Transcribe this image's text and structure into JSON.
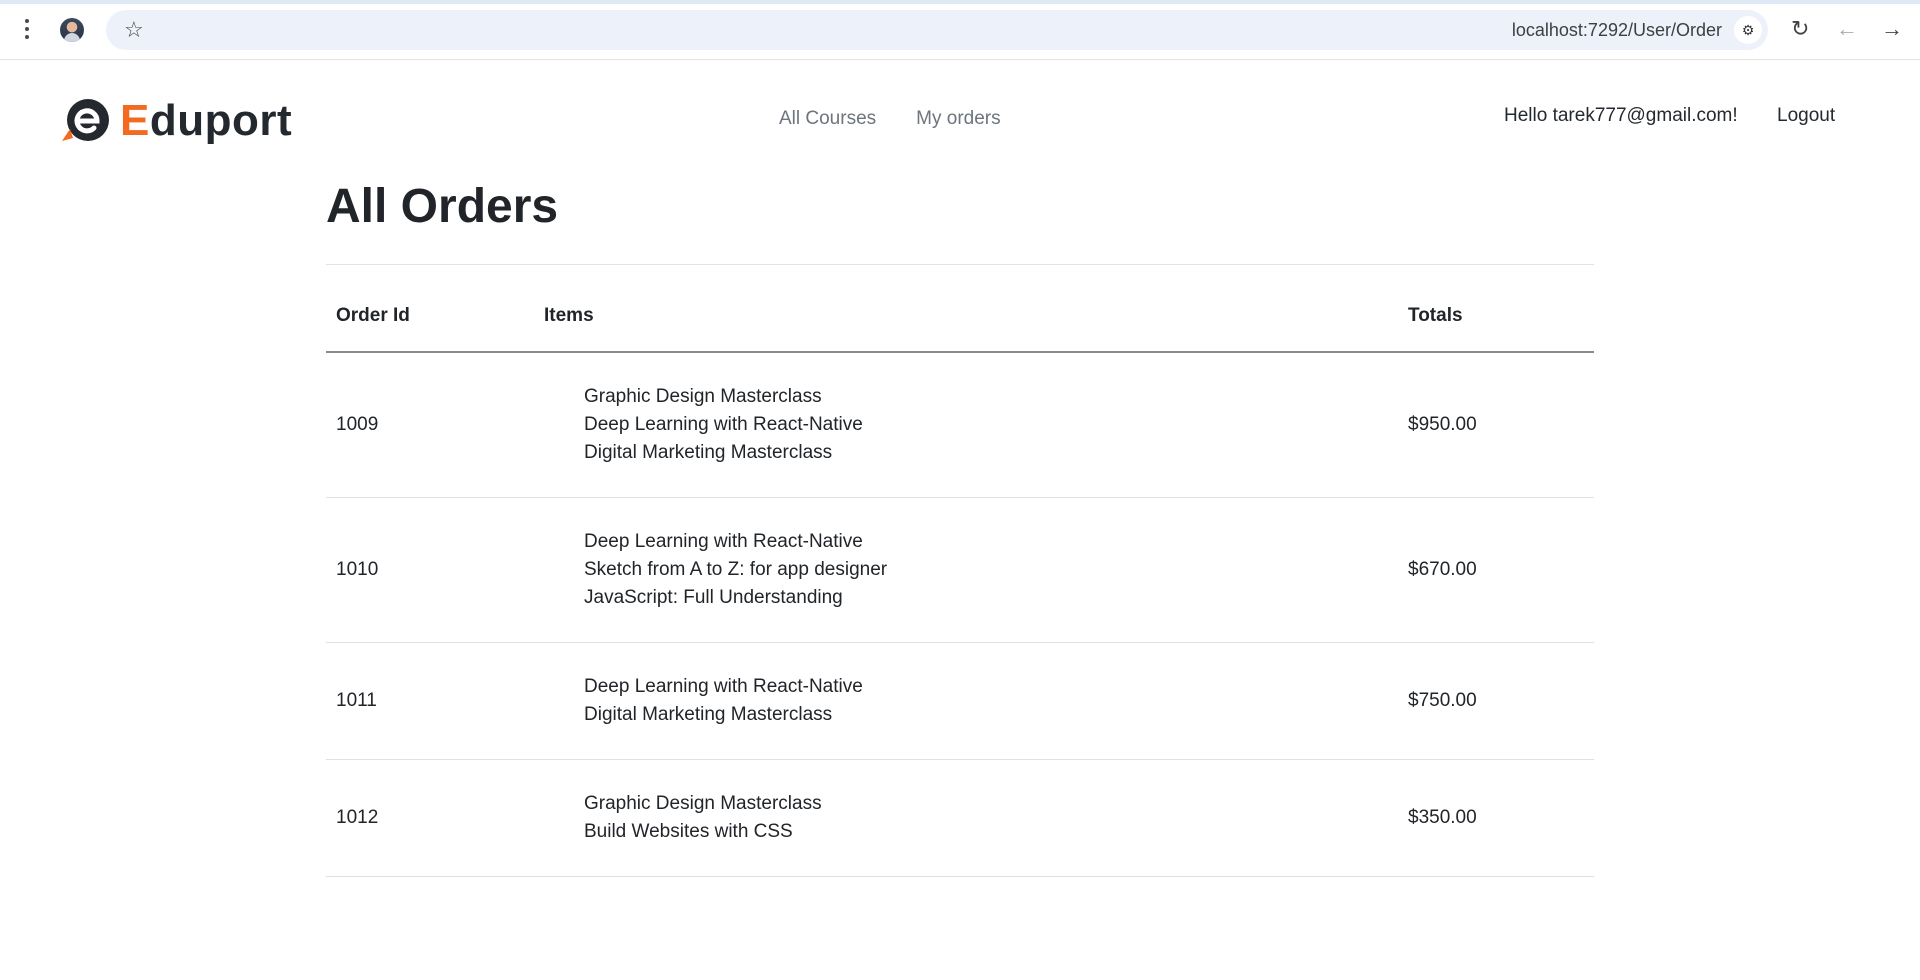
{
  "browser": {
    "url": "localhost:7292/User/Order"
  },
  "header": {
    "logo_initial": "E",
    "logo_rest": "duport",
    "nav": [
      {
        "label": "All Courses"
      },
      {
        "label": "My orders"
      }
    ],
    "greeting": "Hello tarek777@gmail.com!",
    "logout_label": "Logout"
  },
  "main": {
    "title": "All Orders",
    "columns": {
      "order_id": "Order Id",
      "items": "Items",
      "totals": "Totals"
    },
    "orders": [
      {
        "id": "1009",
        "items": [
          "Graphic Design Masterclass",
          "Deep Learning with React-Native",
          "Digital Marketing Masterclass"
        ],
        "total": "$950.00"
      },
      {
        "id": "1010",
        "items": [
          "Deep Learning with React-Native",
          "Sketch from A to Z: for app designer",
          "JavaScript: Full Understanding"
        ],
        "total": "$670.00"
      },
      {
        "id": "1011",
        "items": [
          "Deep Learning with React-Native",
          "Digital Marketing Masterclass"
        ],
        "total": "$750.00"
      },
      {
        "id": "1012",
        "items": [
          "Graphic Design Masterclass",
          "Build Websites with CSS"
        ],
        "total": "$350.00"
      }
    ]
  },
  "colors": {
    "brand_accent": "#f26b21",
    "brand_dark": "#24292f",
    "nav_muted": "#6c757d"
  }
}
